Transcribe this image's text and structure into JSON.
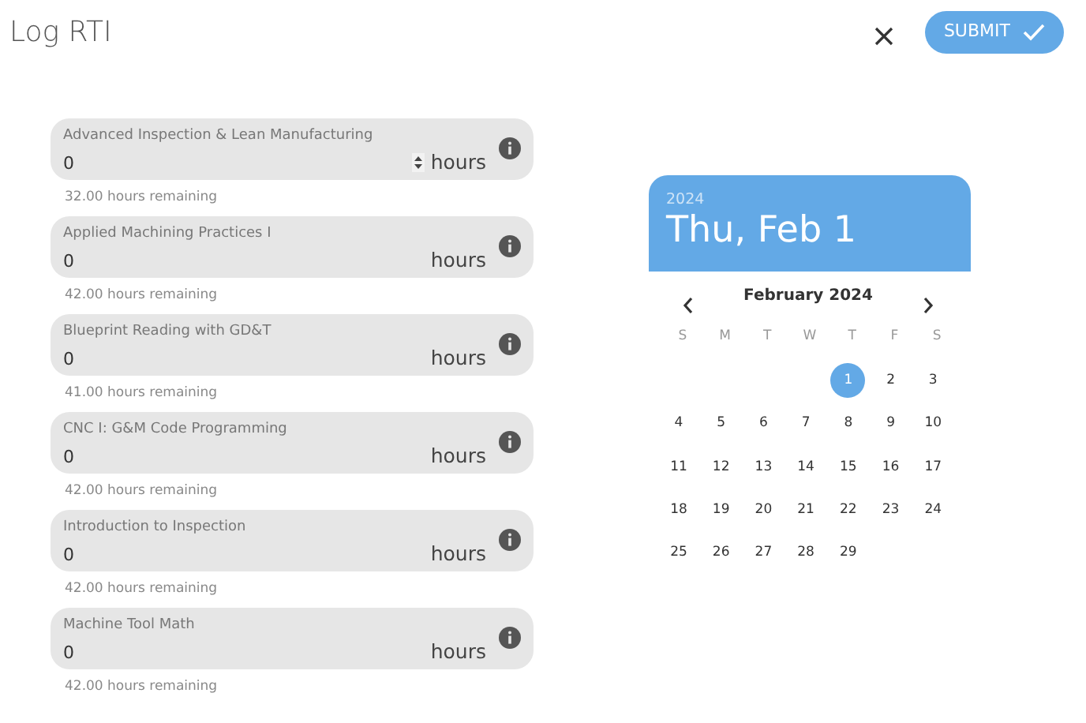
{
  "title": "Log RTI",
  "submit": {
    "label": "SUBMIT"
  },
  "courses": [
    {
      "label": "Advanced Inspection & Lean Manufacturing",
      "value": "0",
      "unit": "hours",
      "remaining": "32.00 hours remaining",
      "spinner": true
    },
    {
      "label": "Applied Machining Practices I",
      "value": "0",
      "unit": "hours",
      "remaining": "42.00 hours remaining",
      "spinner": false
    },
    {
      "label": "Blueprint Reading with GD&T",
      "value": "0",
      "unit": "hours",
      "remaining": "41.00 hours remaining",
      "spinner": false
    },
    {
      "label": "CNC I: G&M Code Programming",
      "value": "0",
      "unit": "hours",
      "remaining": "42.00 hours remaining",
      "spinner": false
    },
    {
      "label": "Introduction to Inspection",
      "value": "0",
      "unit": "hours",
      "remaining": "42.00 hours remaining",
      "spinner": false
    },
    {
      "label": "Machine Tool Math",
      "value": "0",
      "unit": "hours",
      "remaining": "42.00 hours remaining",
      "spinner": false
    }
  ],
  "calendar": {
    "year": "2024",
    "date": "Thu, Feb 1",
    "month": "February 2024",
    "weekdays": [
      "S",
      "M",
      "T",
      "W",
      "T",
      "F",
      "S"
    ],
    "days": [
      {
        "label": "1",
        "selected": true
      },
      {
        "label": "2",
        "selected": false
      },
      {
        "label": "3",
        "selected": false
      },
      {
        "label": "4",
        "selected": false
      },
      {
        "label": "5",
        "selected": false
      },
      {
        "label": "6",
        "selected": false
      },
      {
        "label": "7",
        "selected": false
      },
      {
        "label": "8",
        "selected": false
      },
      {
        "label": "9",
        "selected": false
      },
      {
        "label": "10",
        "selected": false
      },
      {
        "label": "11",
        "selected": false
      },
      {
        "label": "12",
        "selected": false
      },
      {
        "label": "13",
        "selected": false
      },
      {
        "label": "14",
        "selected": false
      },
      {
        "label": "15",
        "selected": false
      },
      {
        "label": "16",
        "selected": false
      },
      {
        "label": "17",
        "selected": false
      },
      {
        "label": "18",
        "selected": false
      },
      {
        "label": "19",
        "selected": false
      },
      {
        "label": "20",
        "selected": false
      },
      {
        "label": "21",
        "selected": false
      },
      {
        "label": "22",
        "selected": false
      },
      {
        "label": "23",
        "selected": false
      },
      {
        "label": "24",
        "selected": false
      },
      {
        "label": "25",
        "selected": false
      },
      {
        "label": "26",
        "selected": false
      },
      {
        "label": "27",
        "selected": false
      },
      {
        "label": "28",
        "selected": false
      },
      {
        "label": "29",
        "selected": false
      }
    ]
  }
}
